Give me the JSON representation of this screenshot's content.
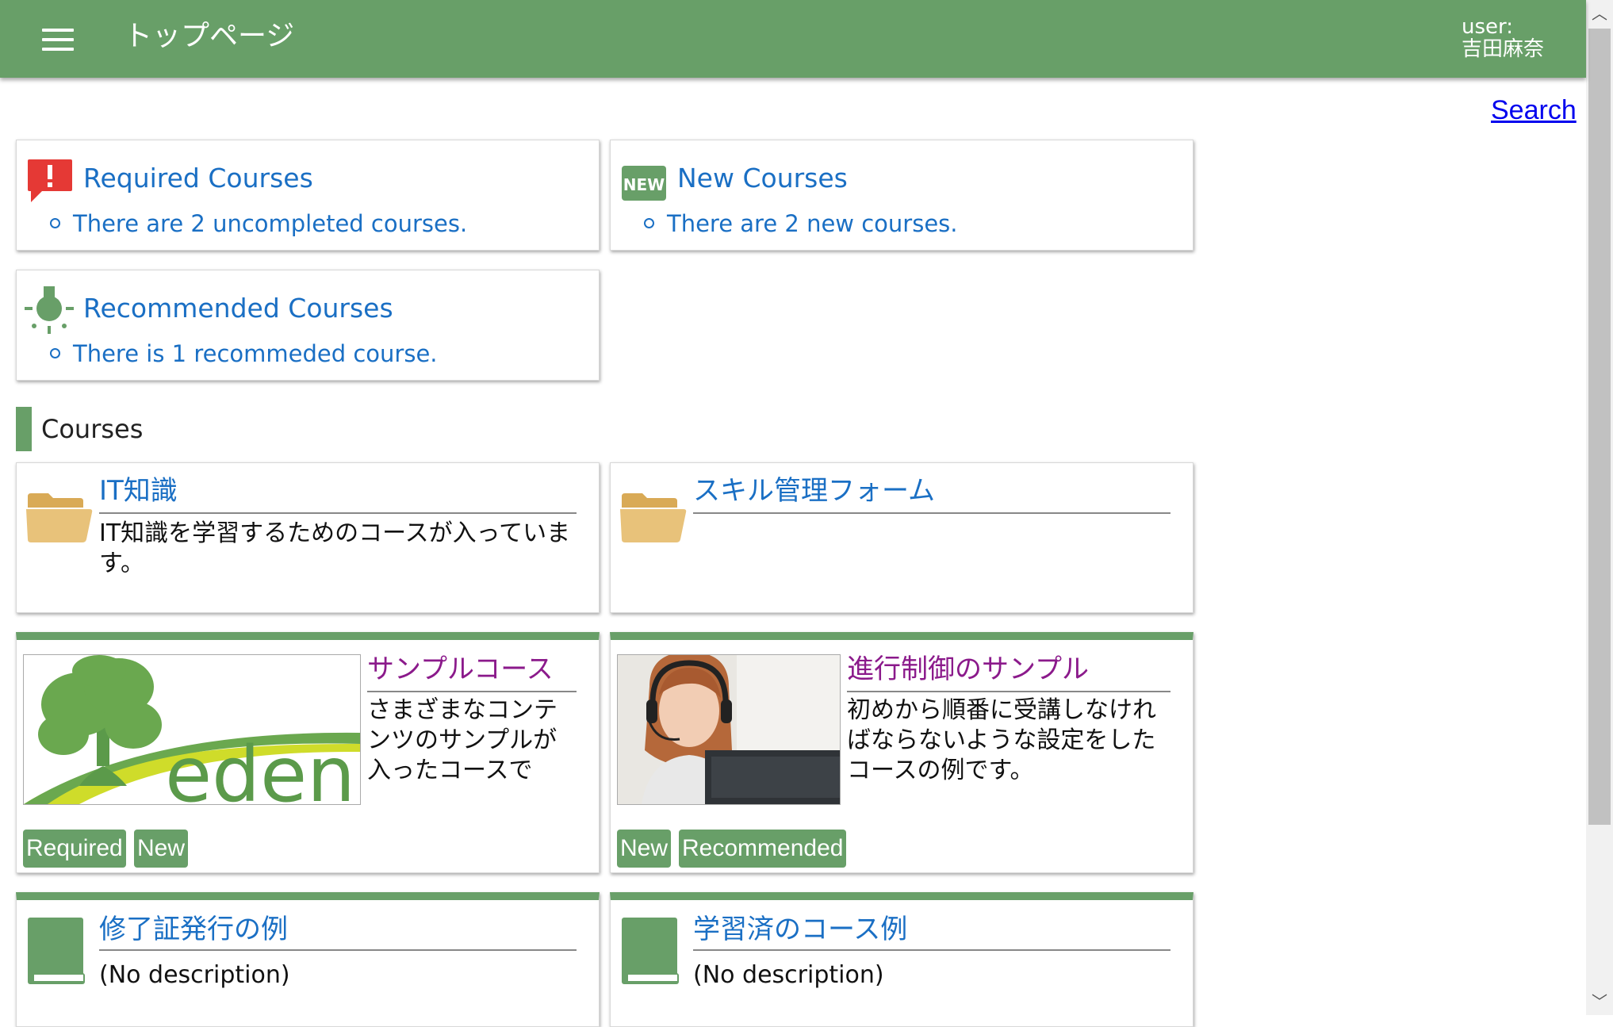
{
  "header": {
    "title": "トップページ",
    "user_label": "user:",
    "user_name": "吉田麻奈"
  },
  "search": {
    "label": "Search"
  },
  "summary": {
    "required": {
      "title": "Required Courses",
      "item": "There are 2 uncompleted courses."
    },
    "new": {
      "title": "New Courses",
      "item": "There are 2 new courses.",
      "icon_text": "NEW"
    },
    "recommended": {
      "title": "Recommended Courses",
      "item": "There is 1 recommeded course."
    }
  },
  "courses_section": {
    "title": "Courses"
  },
  "courses": [
    {
      "title": "IT知識",
      "desc": "IT知識を学習するためのコースが入っています。",
      "icon": "folder-icon"
    },
    {
      "title": "スキル管理フォーム",
      "desc": "",
      "icon": "folder-icon"
    },
    {
      "title": "サンプルコース",
      "desc": "さまざまなコンテンツのサンプルが入ったコースで",
      "image_text": "eden",
      "tags": [
        "Required",
        "New"
      ]
    },
    {
      "title": "進行制御のサンプル",
      "desc": "初めから順番に受講しなければならないような設定をしたコースの例です。",
      "tags": [
        "New",
        "Recommended"
      ]
    },
    {
      "title": "修了証発行の例",
      "desc": "(No description)",
      "icon": "book-icon"
    },
    {
      "title": "学習済のコース例",
      "desc": "(No description)",
      "icon": "book-icon"
    }
  ],
  "colors": {
    "header": "#689f68",
    "link": "#1a6fc4",
    "visited": "#8b1a8b",
    "alert": "#e53935",
    "folder": "#e8c27a"
  }
}
